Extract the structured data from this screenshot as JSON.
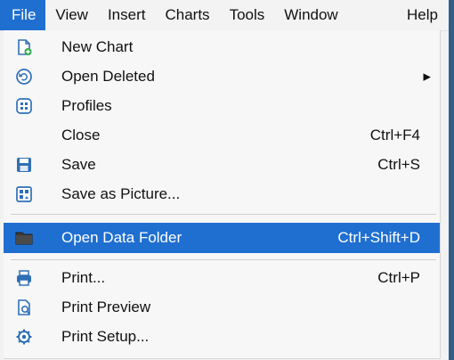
{
  "menubar": {
    "items": [
      "File",
      "View",
      "Insert",
      "Charts",
      "Tools",
      "Window",
      "Help"
    ]
  },
  "file_menu": {
    "items": [
      {
        "label": "New Chart",
        "shortcut": "",
        "icon": "new-chart-icon"
      },
      {
        "label": "Open Deleted",
        "shortcut": "",
        "icon": "open-deleted-icon",
        "submenu": true
      },
      {
        "label": "Profiles",
        "shortcut": "",
        "icon": "profiles-icon"
      },
      {
        "label": "Close",
        "shortcut": "Ctrl+F4",
        "icon": ""
      },
      {
        "label": "Save",
        "shortcut": "Ctrl+S",
        "icon": "save-icon"
      },
      {
        "label": "Save as Picture...",
        "shortcut": "",
        "icon": "save-picture-icon"
      },
      {
        "label": "Open Data Folder",
        "shortcut": "Ctrl+Shift+D",
        "icon": "folder-icon",
        "highlighted": true
      },
      {
        "label": "Print...",
        "shortcut": "Ctrl+P",
        "icon": "print-icon"
      },
      {
        "label": "Print Preview",
        "shortcut": "",
        "icon": "print-preview-icon"
      },
      {
        "label": "Print Setup...",
        "shortcut": "",
        "icon": "print-setup-icon"
      }
    ]
  },
  "colors": {
    "accent": "#1f6fd1",
    "menu_bg": "#f7f7f7",
    "icon_blue": "#2f6fb5",
    "icon_green": "#2aa84a"
  }
}
